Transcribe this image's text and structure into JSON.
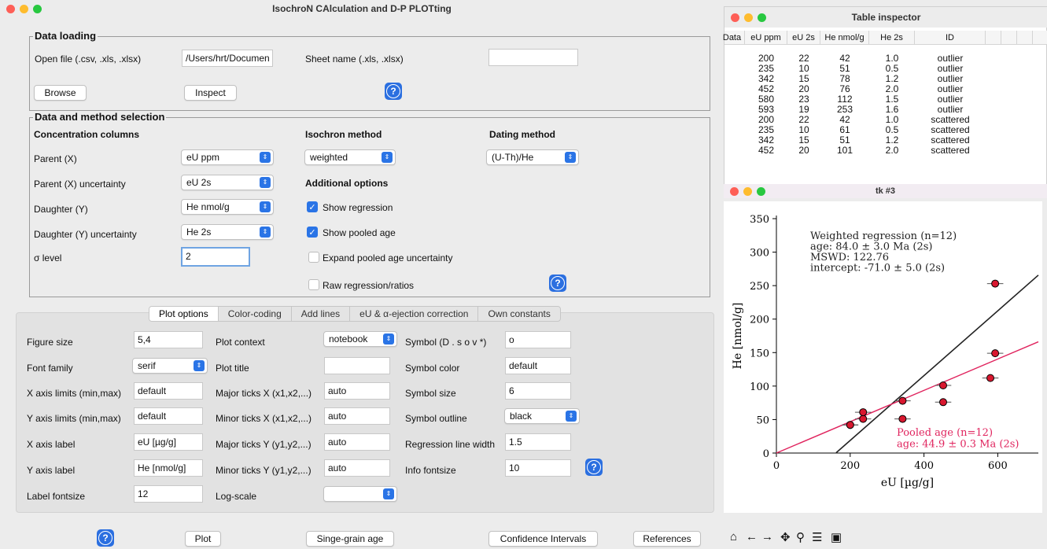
{
  "main_window": {
    "title": "IsochroN CAlculation and D-P PLOTting"
  },
  "data_loading": {
    "title": "Data loading",
    "open_file_label": "Open file (.csv, .xls, .xlsx)",
    "open_file_value": "/Users/hrt/Documen",
    "sheet_label": "Sheet name (.xls, .xlsx)",
    "sheet_value": "",
    "browse": "Browse",
    "inspect": "Inspect"
  },
  "method": {
    "title": "Data and method selection",
    "conc_header": "Concentration columns",
    "isochron_header": "Isochron method",
    "dating_header": "Dating method",
    "parent_x": "Parent (X)",
    "parent_x_value": "eU ppm",
    "parent_x_unc": "Parent (X) uncertainty",
    "parent_x_unc_value": "eU 2s",
    "daughter_y": "Daughter (Y)",
    "daughter_y_value": "He nmol/g",
    "daughter_y_unc": "Daughter (Y) uncertainty",
    "daughter_y_unc_value": "He 2s",
    "sigma": "σ level",
    "sigma_value": "2",
    "isochron_value": "weighted",
    "dating_value": "(U-Th)/He",
    "additional_header": "Additional options",
    "opt_regression": "Show regression",
    "opt_pooled": "Show pooled age",
    "opt_expand": "Expand pooled age uncertainty",
    "opt_raw": "Raw regression/ratios"
  },
  "tabs": [
    "Plot options",
    "Color-coding",
    "Add lines",
    "eU & α-ejection correction",
    "Own constants"
  ],
  "plot_options": {
    "figure_size": "Figure size",
    "figure_size_value": "5,4",
    "font_family": "Font family",
    "font_family_value": "serif",
    "xlim": "X axis limits (min,max)",
    "xlim_value": "default",
    "ylim": "Y axis limits (min,max)",
    "ylim_value": "default",
    "xlabel": "X axis label",
    "xlabel_value": "eU [µg/g]",
    "ylabel": "Y axis label",
    "ylabel_value": "He [nmol/g]",
    "label_fontsize": "Label fontsize",
    "label_fontsize_value": "12",
    "plot_context": "Plot context",
    "plot_context_value": "notebook",
    "plot_title": "Plot title",
    "plot_title_value": "",
    "major_x": "Major ticks X (x1,x2,...)",
    "major_x_value": "auto",
    "minor_x": "Minor ticks X (x1,x2,...)",
    "minor_x_value": "auto",
    "major_y": "Major ticks Y (y1,y2,...)",
    "major_y_value": "auto",
    "minor_y": "Minor ticks Y (y1,y2,...)",
    "minor_y_value": "auto",
    "log_scale": "Log-scale",
    "log_scale_value": "",
    "symbol": "Symbol (D . s o v *)",
    "symbol_value": "o",
    "symbol_color": "Symbol color",
    "symbol_color_value": "default",
    "symbol_size": "Symbol size",
    "symbol_size_value": "6",
    "symbol_outline": "Symbol outline",
    "symbol_outline_value": "black",
    "reg_width": "Regression line width",
    "reg_width_value": "1.5",
    "info_fontsize": "Info fontsize",
    "info_fontsize_value": "10"
  },
  "bottom_buttons": {
    "plot": "Plot",
    "single": "Singe-grain age",
    "ci": "Confidence Intervals",
    "refs": "References"
  },
  "table_inspector": {
    "title": "Table inspector",
    "columns": [
      "Data",
      "eU ppm",
      "eU 2s",
      "He nmol/g",
      "He 2s",
      "ID"
    ],
    "rows": [
      [
        "200",
        "22",
        "42",
        "1.0",
        "outlier"
      ],
      [
        "235",
        "10",
        "51",
        "0.5",
        "outlier"
      ],
      [
        "342",
        "15",
        "78",
        "1.2",
        "outlier"
      ],
      [
        "452",
        "20",
        "76",
        "2.0",
        "outlier"
      ],
      [
        "580",
        "23",
        "112",
        "1.5",
        "outlier"
      ],
      [
        "593",
        "19",
        "253",
        "1.6",
        "outlier"
      ],
      [
        "200",
        "22",
        "42",
        "1.0",
        "scattered"
      ],
      [
        "235",
        "10",
        "61",
        "0.5",
        "scattered"
      ],
      [
        "342",
        "15",
        "51",
        "1.2",
        "scattered"
      ],
      [
        "452",
        "20",
        "101",
        "2.0",
        "scattered"
      ]
    ]
  },
  "plot_window": {
    "title": "tk #3"
  },
  "chart_data": {
    "type": "scatter",
    "xlabel": "eU [µg/g]",
    "ylabel": "He [nmol/g]",
    "xlim": [
      0,
      710
    ],
    "ylim": [
      0,
      350
    ],
    "xticks": [
      0,
      200,
      400,
      600
    ],
    "yticks": [
      0,
      50,
      100,
      150,
      200,
      250,
      300,
      350
    ],
    "points": [
      {
        "x": 200,
        "y": 42
      },
      {
        "x": 235,
        "y": 51
      },
      {
        "x": 342,
        "y": 78
      },
      {
        "x": 452,
        "y": 76
      },
      {
        "x": 580,
        "y": 112
      },
      {
        "x": 593,
        "y": 253
      },
      {
        "x": 200,
        "y": 42
      },
      {
        "x": 235,
        "y": 61
      },
      {
        "x": 342,
        "y": 51
      },
      {
        "x": 452,
        "y": 101
      },
      {
        "x": 593,
        "y": 149
      }
    ],
    "regression_line": {
      "slope": 0.484,
      "intercept": -78,
      "color": "#222222"
    },
    "pooled_line": {
      "slope": 0.234,
      "intercept": 0,
      "color": "#e0245e"
    },
    "info_regression": [
      "Weighted regression (n=12)",
      "age: 84.0 ± 3.0 Ma (2s)",
      "MSWD: 122.76",
      "intercept: -71.0 ± 5.0 (2s)"
    ],
    "info_pooled": [
      "Pooled age (n=12)",
      "age: 44.9 ± 0.3 Ma (2s)"
    ]
  },
  "toolbar_icons": [
    "home-icon",
    "back-icon",
    "forward-icon",
    "pan-icon",
    "zoom-icon",
    "configure-icon",
    "save-icon"
  ]
}
